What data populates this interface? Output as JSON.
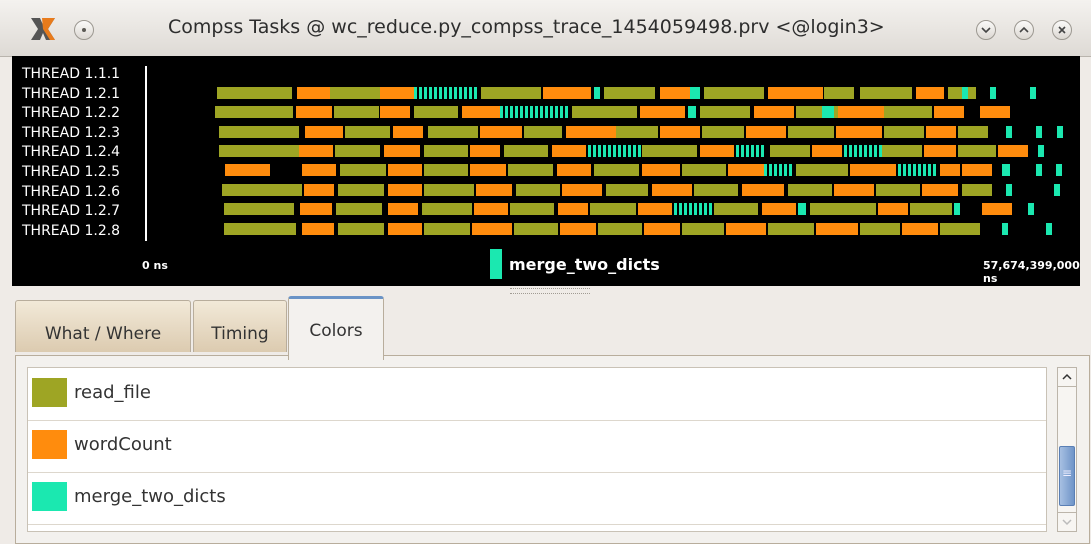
{
  "window": {
    "title": "Compss Tasks @ wc_reduce.py_compss_trace_1454059498.prv <@login3>"
  },
  "timeline": {
    "threads": [
      "THREAD 1.1.1",
      "THREAD 1.2.1",
      "THREAD 1.2.2",
      "THREAD 1.2.3",
      "THREAD 1.2.4",
      "THREAD 1.2.5",
      "THREAD 1.2.6",
      "THREAD 1.2.7",
      "THREAD 1.2.8"
    ],
    "axis_start": "0 ns",
    "axis_end": "57,674,399,000 ns",
    "hover_label": "merge_two_dicts",
    "colors": {
      "read_file": "#9ea524",
      "wordCount": "#ff8c0d",
      "merge_two_dicts": "#1be8b0",
      "background": "#000000"
    }
  },
  "tabs": [
    {
      "label": "What / Where"
    },
    {
      "label": "Timing"
    },
    {
      "label": "Colors",
      "active": true
    }
  ],
  "legend": [
    {
      "label": "read_file",
      "color": "#9ea524"
    },
    {
      "label": "wordCount",
      "color": "#ff8c0d"
    },
    {
      "label": "merge_two_dicts",
      "color": "#1be8b0"
    }
  ]
}
